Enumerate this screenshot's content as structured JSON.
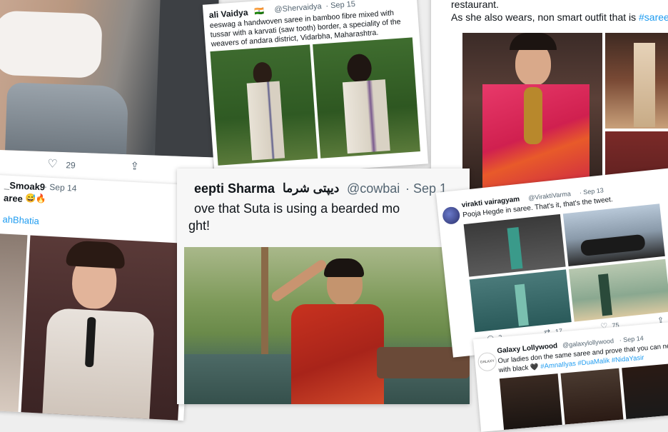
{
  "card_top_left": {
    "like_count": "29"
  },
  "card_top_mid": {
    "author_name": "ali Vaidya",
    "flag": "🇮🇳",
    "handle": "@Shervaidya",
    "date": "· Sep 15",
    "text": "eeswag a handwoven saree in bamboo fibre mixed with tussar with a karvati (saw tooth) border, a speciality of the weavers of andara district, Vidarbha, Maharashtra."
  },
  "card_top_right": {
    "line1": "restaurant.",
    "line2_prefix": "As she also wears, non smart outfit that is ",
    "line2_hashtag": "#saree"
  },
  "card_mid_left": {
    "handle": "_Smoak9",
    "date": "· Sep 14",
    "text": "aree",
    "emoji": "😅🔥",
    "mention": "ahBhatia"
  },
  "card_mid_center": {
    "name_latin": "eepti Sharma",
    "name_urdu": "دیپتی شرما",
    "handle": "@cowbai",
    "date": "· Sep 1",
    "line1": "ove that Suta is using a bearded mo",
    "line2": "ght!"
  },
  "card_right_tweet": {
    "author_name": "virakti vairagyam",
    "handle": "@ViraktiVarma",
    "date": "· Sep 13",
    "text": "Pooja Hegde in saree. That's it, that's the tweet.",
    "reply_count": "2",
    "retweet_count": "17",
    "like_count": "75"
  },
  "card_galaxy": {
    "author_name": "Galaxy Lollywood",
    "handle": "@galaxylollywood",
    "date": "· Sep 14",
    "text_prefix": "Our ladies don the same saree and prove that you can never go wrong",
    "text2_prefix": "with black 🖤 ",
    "hashtags": "#AmnaIlyas #DuaMalik #NidaYasir",
    "logo_text": "GALAXY"
  },
  "colors": {
    "link": "#1d9bf0",
    "muted": "#536471",
    "text": "#0f1419"
  }
}
